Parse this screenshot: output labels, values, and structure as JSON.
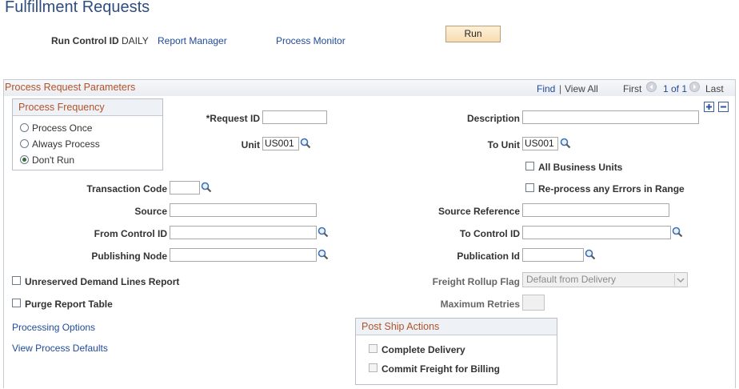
{
  "page_title": "Fulfillment Requests",
  "header": {
    "run_control_label": "Run Control ID",
    "run_control_value": "DAILY",
    "report_manager": "Report Manager",
    "process_monitor": "Process Monitor",
    "run_button": "Run"
  },
  "section": {
    "title": "Process Request Parameters",
    "find": "Find",
    "separator": "|",
    "view_all": "View All",
    "first": "First",
    "page_of": "1 of 1",
    "last": "Last"
  },
  "frequency": {
    "title": "Process Frequency",
    "options": [
      "Process Once",
      "Always Process",
      "Don't Run"
    ],
    "selected": "Don't Run"
  },
  "fields": {
    "request_id_label": "*Request ID",
    "request_id_value": "",
    "description_label": "Description",
    "description_value": "",
    "unit_label": "Unit",
    "unit_value": "US001",
    "to_unit_label": "To Unit",
    "to_unit_value": "US001",
    "all_business_units": "All Business Units",
    "transaction_code_label": "Transaction Code",
    "transaction_code_value": "",
    "reprocess_errors": "Re-process any Errors in Range",
    "source_label": "Source",
    "source_value": "",
    "source_reference_label": "Source Reference",
    "source_reference_value": "",
    "from_control_id_label": "From Control ID",
    "from_control_id_value": "",
    "to_control_id_label": "To Control ID",
    "to_control_id_value": "",
    "publishing_node_label": "Publishing Node",
    "publishing_node_value": "",
    "publication_id_label": "Publication Id",
    "publication_id_value": "",
    "unreserved_demand": "Unreserved Demand Lines Report",
    "freight_rollup_label": "Freight Rollup Flag",
    "freight_rollup_value": "Default from Delivery",
    "purge_report_table": "Purge Report Table",
    "maximum_retries_label": "Maximum Retries",
    "maximum_retries_value": ""
  },
  "links": {
    "processing_options": "Processing Options",
    "view_process_defaults": "View Process Defaults"
  },
  "post_ship": {
    "title": "Post Ship Actions",
    "complete_delivery": "Complete Delivery",
    "commit_freight": "Commit Freight for Billing"
  },
  "icons": {
    "lookup": "magnifier-icon",
    "add_row": "plus-icon",
    "delete_row": "minus-icon",
    "prev": "left-arrow-icon",
    "next": "right-arrow-icon"
  },
  "colors": {
    "title_blue": "#2f4e80",
    "section_title_orange": "#b1532a",
    "link_blue": "#1f4a9a",
    "run_button_bg": "#f7dcb0"
  }
}
